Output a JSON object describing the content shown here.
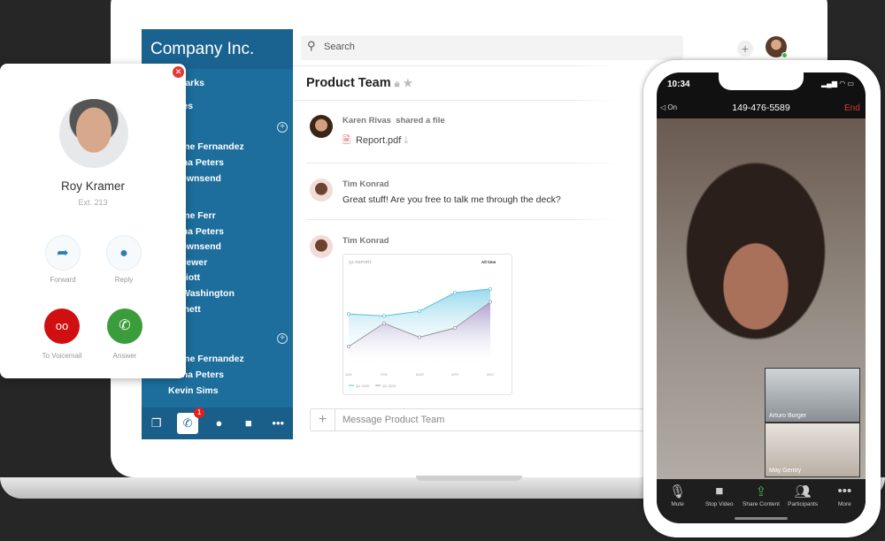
{
  "sidebar": {
    "title": "Company Inc.",
    "items": [
      {
        "label": "marks",
        "section": true
      },
      {
        "label": "ites",
        "section": true
      },
      {
        "label": "e",
        "section": true
      },
      {
        "label": "ueline Fernandez"
      },
      {
        "label": "antha Peters"
      },
      {
        "label": "e Townsend"
      },
      {
        "label": "le",
        "section": true
      },
      {
        "label": "ueline Ferr"
      },
      {
        "label": "antha Peters"
      },
      {
        "label": "e Townsend"
      },
      {
        "label": "a Brewer"
      },
      {
        "label": "r Elliott"
      },
      {
        "label": "en Washington"
      },
      {
        "label": "Barnett"
      },
      {
        "label": "s",
        "section": true
      },
      {
        "label": "ueline Fernandez"
      },
      {
        "label": "antha Peters"
      },
      {
        "label": "Kevin Sims"
      }
    ],
    "call_badge": "1"
  },
  "search": {
    "placeholder": "Search"
  },
  "channel": {
    "title": "Product Team"
  },
  "messages": [
    {
      "author": "Karen Rivas",
      "action": "shared a file",
      "file": "Report.pdf"
    },
    {
      "author": "Tim Konrad",
      "text": "Great stuff! Are you free to talk me through the deck?"
    },
    {
      "author": "Tim Konrad"
    }
  ],
  "composer": {
    "placeholder": "Message Product Team"
  },
  "chart_data": {
    "type": "area",
    "title": "Q1 REPORT",
    "filter": "All time",
    "categories": [
      "JAN",
      "FEB",
      "MAR",
      "APR",
      "MAY"
    ],
    "series": [
      {
        "name": "Q1 2020",
        "values": [
          55,
          53,
          58,
          78,
          82
        ],
        "color": "#5bbfe0"
      },
      {
        "name": "Q1 2019",
        "values": [
          20,
          45,
          30,
          40,
          68
        ],
        "color": "#999999"
      }
    ],
    "ylim": [
      0,
      100
    ]
  },
  "incoming_call": {
    "name": "Roy Kramer",
    "ext": "Ext. 213",
    "forward": "Forward",
    "reply": "Reply",
    "voicemail": "To Voicemail",
    "answer": "Answer"
  },
  "phone": {
    "time": "10:34",
    "speaker": "On",
    "number": "149-476-5589",
    "end": "End",
    "participants": [
      "Arturo Borger",
      "May Gentry"
    ],
    "controls": [
      "Mute",
      "Stop Video",
      "Share Content",
      "Participants",
      "More"
    ]
  },
  "colors": {
    "sidebar": "#1d6e9d",
    "answer": "#3a9c3a",
    "voicemail": "#d01010"
  }
}
